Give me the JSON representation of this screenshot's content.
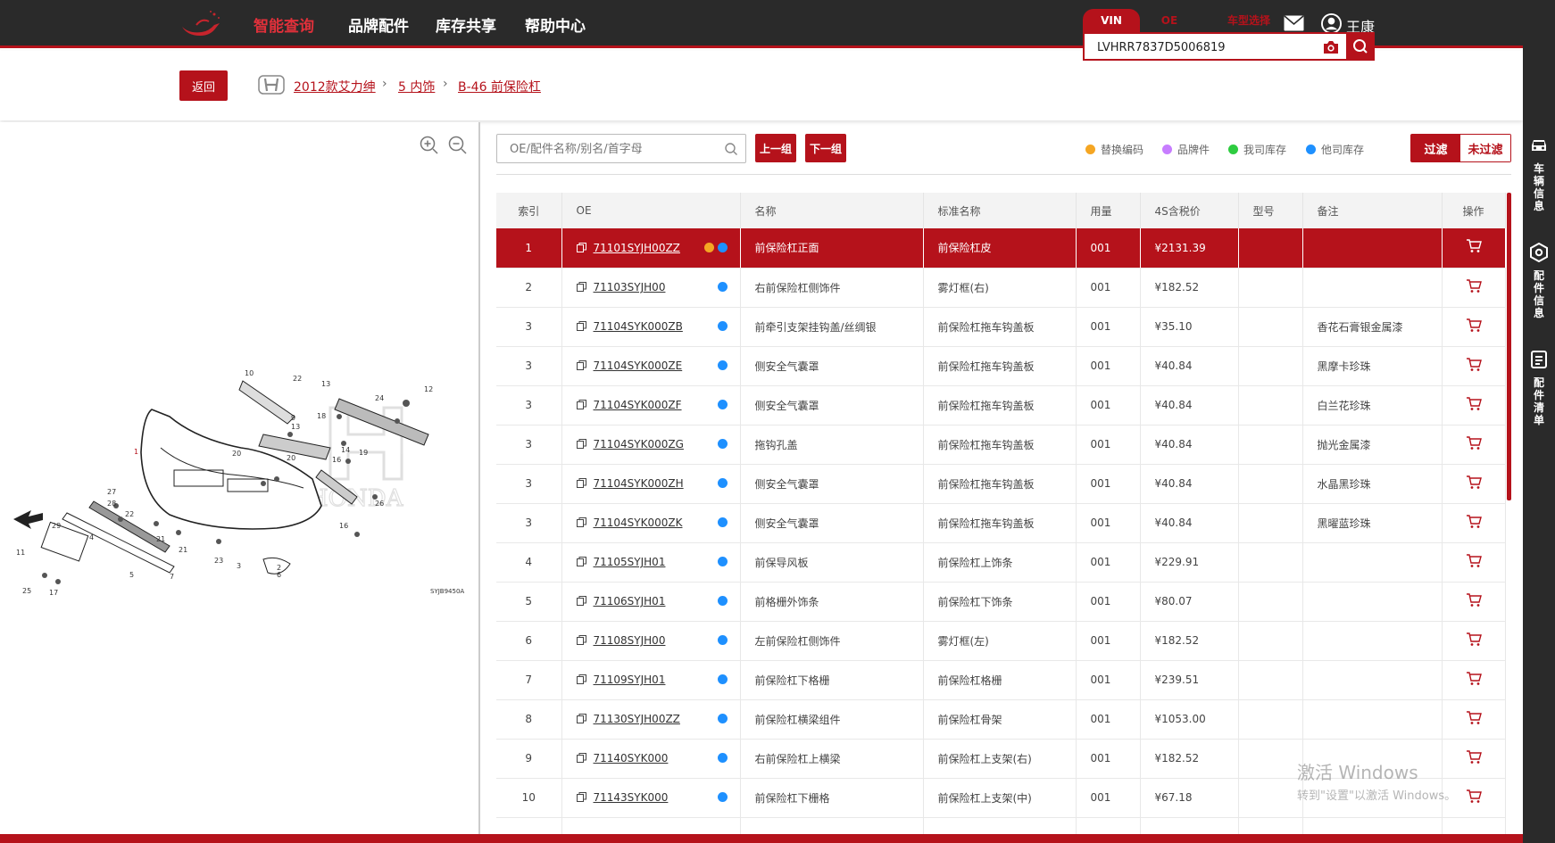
{
  "nav": {
    "items": [
      "智能查询",
      "品牌配件",
      "库存共享",
      "帮助中心"
    ],
    "user_name": "王康"
  },
  "breadcrumb": {
    "back_label": "返回",
    "items": [
      "2012款艾力绅",
      "5 内饰",
      "B-46 前保险杠"
    ]
  },
  "vin": {
    "tabs": [
      "VIN",
      "OE",
      "车型选择"
    ],
    "value": "LVHRR7837D5006819"
  },
  "diagram": {
    "brand_watermark": "HONDA",
    "code": "SYJB9450A"
  },
  "toolbar": {
    "search_placeholder": "OE/配件名称/别名/首字母",
    "prev_group": "上一组",
    "next_group": "下一组",
    "filter": "过滤",
    "no_filter": "未过滤"
  },
  "legend": [
    {
      "label": "替换编码",
      "color": "#f5a623"
    },
    {
      "label": "品牌件",
      "color": "#c77dff"
    },
    {
      "label": "我司库存",
      "color": "#2ecc40"
    },
    {
      "label": "他司库存",
      "color": "#1e90ff"
    }
  ],
  "table": {
    "columns": [
      "索引",
      "OE",
      "名称",
      "标准名称",
      "用量",
      "4S含税价",
      "型号",
      "备注",
      "操作"
    ],
    "rows": [
      {
        "index": "1",
        "oe": "71101SYJH00ZZ",
        "name": "前保险杠正面",
        "std_name": "前保险杠皮",
        "qty": "001",
        "price": "¥2131.39",
        "model": "",
        "note": "",
        "dots": [
          "#f5a623",
          "#1e90ff"
        ],
        "selected": true
      },
      {
        "index": "2",
        "oe": "71103SYJH00",
        "name": "右前保险杠侧饰件",
        "std_name": "雾灯框(右)",
        "qty": "001",
        "price": "¥182.52",
        "model": "",
        "note": "",
        "dots": [
          "#1e90ff"
        ]
      },
      {
        "index": "3",
        "oe": "71104SYK000ZB",
        "name": "前牵引支架挂钩盖/丝绸银",
        "std_name": "前保险杠拖车钩盖板",
        "qty": "001",
        "price": "¥35.10",
        "model": "",
        "note": "香花石膏银金属漆",
        "dots": [
          "#1e90ff"
        ]
      },
      {
        "index": "3",
        "oe": "71104SYK000ZE",
        "name": "侧安全气囊罩",
        "std_name": "前保险杠拖车钩盖板",
        "qty": "001",
        "price": "¥40.84",
        "model": "",
        "note": "黑摩卡珍珠",
        "dots": [
          "#1e90ff"
        ]
      },
      {
        "index": "3",
        "oe": "71104SYK000ZF",
        "name": "侧安全气囊罩",
        "std_name": "前保险杠拖车钩盖板",
        "qty": "001",
        "price": "¥40.84",
        "model": "",
        "note": "白兰花珍珠",
        "dots": [
          "#1e90ff"
        ]
      },
      {
        "index": "3",
        "oe": "71104SYK000ZG",
        "name": "拖钩孔盖",
        "std_name": "前保险杠拖车钩盖板",
        "qty": "001",
        "price": "¥40.84",
        "model": "",
        "note": "抛光金属漆",
        "dots": [
          "#1e90ff"
        ]
      },
      {
        "index": "3",
        "oe": "71104SYK000ZH",
        "name": "侧安全气囊罩",
        "std_name": "前保险杠拖车钩盖板",
        "qty": "001",
        "price": "¥40.84",
        "model": "",
        "note": "水晶黑珍珠",
        "dots": [
          "#1e90ff"
        ]
      },
      {
        "index": "3",
        "oe": "71104SYK000ZK",
        "name": "侧安全气囊罩",
        "std_name": "前保险杠拖车钩盖板",
        "qty": "001",
        "price": "¥40.84",
        "model": "",
        "note": "黑曜蓝珍珠",
        "dots": [
          "#1e90ff"
        ]
      },
      {
        "index": "4",
        "oe": "71105SYJH01",
        "name": "前保导风板",
        "std_name": "前保险杠上饰条",
        "qty": "001",
        "price": "¥229.91",
        "model": "",
        "note": "",
        "dots": [
          "#1e90ff"
        ]
      },
      {
        "index": "5",
        "oe": "71106SYJH01",
        "name": "前格栅外饰条",
        "std_name": "前保险杠下饰条",
        "qty": "001",
        "price": "¥80.07",
        "model": "",
        "note": "",
        "dots": [
          "#1e90ff"
        ]
      },
      {
        "index": "6",
        "oe": "71108SYJH00",
        "name": "左前保险杠侧饰件",
        "std_name": "雾灯框(左)",
        "qty": "001",
        "price": "¥182.52",
        "model": "",
        "note": "",
        "dots": [
          "#1e90ff"
        ]
      },
      {
        "index": "7",
        "oe": "71109SYJH01",
        "name": "前保险杠下格栅",
        "std_name": "前保险杠格栅",
        "qty": "001",
        "price": "¥239.51",
        "model": "",
        "note": "",
        "dots": [
          "#1e90ff"
        ]
      },
      {
        "index": "8",
        "oe": "71130SYJH00ZZ",
        "name": "前保险杠横梁组件",
        "std_name": "前保险杠骨架",
        "qty": "001",
        "price": "¥1053.00",
        "model": "",
        "note": "",
        "dots": [
          "#1e90ff"
        ]
      },
      {
        "index": "9",
        "oe": "71140SYK000",
        "name": "右前保险杠上横梁",
        "std_name": "前保险杠上支架(右)",
        "qty": "001",
        "price": "¥182.52",
        "model": "",
        "note": "",
        "dots": [
          "#1e90ff"
        ]
      },
      {
        "index": "10",
        "oe": "71143SYK000",
        "name": "前保险杠下栅格",
        "std_name": "前保险杠上支架(中)",
        "qty": "001",
        "price": "¥67.18",
        "model": "",
        "note": "",
        "dots": [
          "#1e90ff"
        ]
      },
      {
        "index": "",
        "oe": "",
        "name": "",
        "std_name": "",
        "qty": "",
        "price": "",
        "model": "",
        "note": "",
        "dots": []
      }
    ]
  },
  "sidebar": {
    "items": [
      "车辆信息",
      "配件信息",
      "配件清单"
    ]
  },
  "watermark": {
    "title": "激活 Windows",
    "subtitle": "转到\"设置\"以激活 Windows。"
  },
  "colors": {
    "brand": "#b5121b",
    "nav_bg": "#2a2a2a"
  }
}
